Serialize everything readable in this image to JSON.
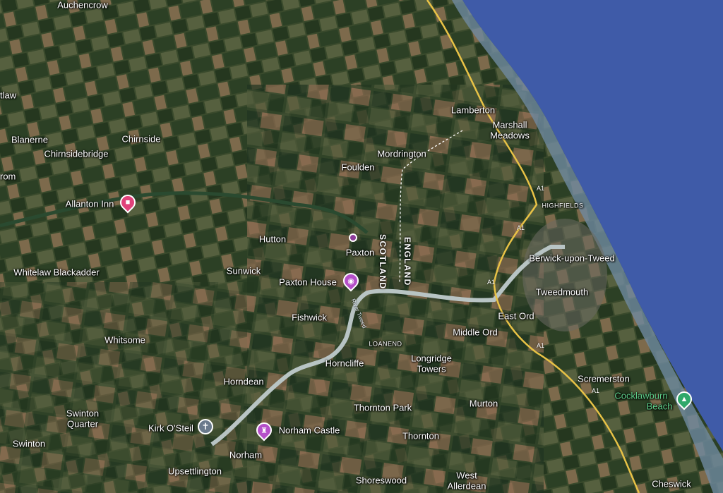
{
  "map": {
    "type": "satellite",
    "colors": {
      "sea": "#3f5ba8",
      "land": "#3a4a2c",
      "field_dark": "#24361f",
      "field_brown": "#8a6a4c",
      "river": "#b8c4c4",
      "road": "#e8c246",
      "border": "#ffffff",
      "hotel_pin": "#e0427a",
      "attraction_pin": "#b550c9",
      "castle_pin": "#b550c9",
      "beach_pin": "#2fa86a",
      "place_dot": "#8e3d9b"
    }
  },
  "places": {
    "auchencrow": "Auchencrow",
    "tlaw": "tlaw",
    "blanerne": "Blanerne",
    "chirnside": "Chirnside",
    "chirnsidebridge": "Chirnsidebridge",
    "rom": "rom",
    "allanton_inn": "Allanton Inn",
    "hutton": "Hutton",
    "whitelaw_blackadder": "Whitelaw Blackadder",
    "sunwick": "Sunwick",
    "paxton_house": "Paxton House",
    "fishwick": "Fishwick",
    "whitsome": "Whitsome",
    "horndean": "Horndean",
    "swinton_quarter_1": "Swinton",
    "swinton_quarter_2": "Quarter",
    "swinton": "Swinton",
    "kirk_osteil": "Kirk O'Steil",
    "norham_castle": "Norham Castle",
    "norham": "Norham",
    "upsettlington": "Upsettlington",
    "lamberton": "Lamberton",
    "marshall_meadows_1": "Marshall",
    "marshall_meadows_2": "Meadows",
    "mordrington": "Mordrington",
    "foulden": "Foulden",
    "paxton": "Paxton",
    "highfields": "HIGHFIELDS",
    "berwick": "Berwick-upon-Tweed",
    "tweedmouth": "Tweedmouth",
    "east_ord": "East Ord",
    "middle_ord": "Middle Ord",
    "loanend": "LOANEND",
    "horncliffe": "Horncliffe",
    "longridge_towers_1": "Longridge",
    "longridge_towers_2": "Towers",
    "thornton_park": "Thornton Park",
    "murton": "Murton",
    "thornton": "Thornton",
    "scremerston": "Scremerston",
    "cocklawburn_beach_1": "Cocklawburn",
    "cocklawburn_beach_2": "Beach",
    "shoreswood": "Shoreswood",
    "west_allerdean_1": "West",
    "west_allerdean_2": "Allerdean",
    "cheswick": "Cheswick"
  },
  "borders": {
    "scotland": "SCOTLAND",
    "england": "ENGLAND"
  },
  "river_label": "River Tweed",
  "road_labels": {
    "a1_1": "A1",
    "a1_2": "A1",
    "a1_3": "A1",
    "a1_4": "A1",
    "a1_5": "A1"
  },
  "icons": {
    "hotel": "bed-icon",
    "attraction": "camera-icon",
    "castle": "castle-icon",
    "beach": "beach-icon",
    "church": "cross-icon"
  }
}
